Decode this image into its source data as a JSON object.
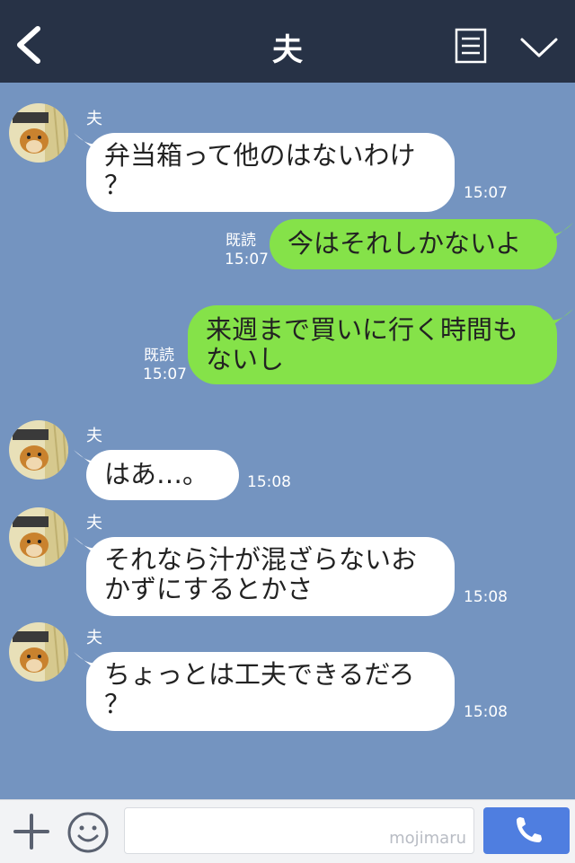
{
  "header": {
    "title": "夫",
    "back_icon": "chevron-left-icon",
    "memo_icon": "notes-icon",
    "menu_icon": "chevron-down-icon",
    "bg_color": "#273246"
  },
  "chat": {
    "bg_color": "#7494c0",
    "messages": [
      {
        "from": "夫",
        "text_line1": "弁当箱って他のはないわけ",
        "text_line2": "？",
        "time": "15:07"
      },
      {
        "from": "me",
        "text": "今はそれしかないよ",
        "read": "既読",
        "time": "15:07"
      },
      {
        "from": "me",
        "text_line1": "来週まで買いに行く時間も",
        "text_line2": "ないし",
        "read": "既読",
        "time": "15:07"
      },
      {
        "from": "夫",
        "text": "はあ…。",
        "time": "15:08"
      },
      {
        "from": "夫",
        "text_line1": "それなら汁が混ざらないお",
        "text_line2": "かずにするとかさ",
        "time": "15:08"
      },
      {
        "from": "夫",
        "text_line1": "ちょっとは工夫できるだろ",
        "text_line2": "？",
        "time": "15:08"
      }
    ]
  },
  "footer": {
    "plus_icon": "plus-icon",
    "emoji_icon": "smiley-icon",
    "watermark": "mojimaru",
    "call_icon": "phone-icon",
    "call_color": "#4f7ee0"
  }
}
